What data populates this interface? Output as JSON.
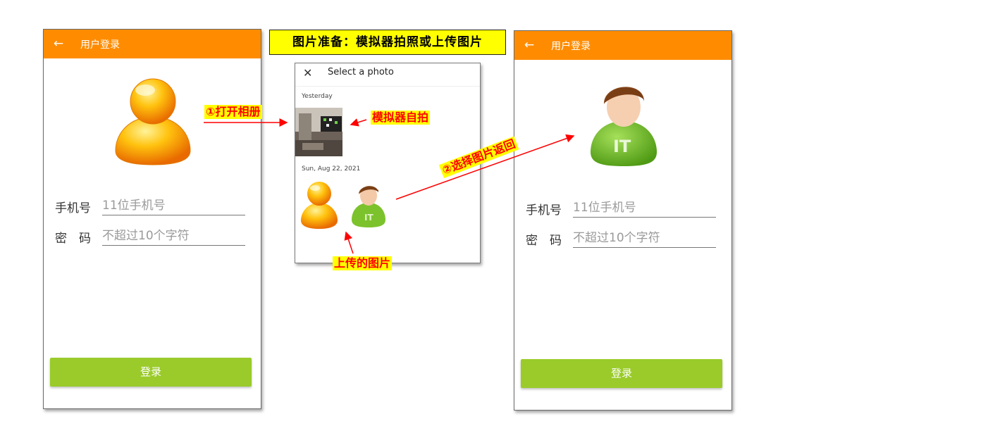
{
  "banner": {
    "text": "图片准备：模拟器拍照或上传图片"
  },
  "login_screen_before": {
    "appbar": {
      "back_icon": "←",
      "title": "用户登录"
    },
    "phone_label": "手机号",
    "phone_placeholder": "11位手机号",
    "password_label": "密　码",
    "password_placeholder": "不超过10个字符",
    "login_button": "登录",
    "avatar_icon": "orange-person-avatar"
  },
  "photo_picker": {
    "close_icon": "✕",
    "title": "Select a photo",
    "sections": [
      {
        "label": "Yesterday",
        "photos": [
          "emulator-selfie"
        ]
      },
      {
        "label": "Sun, Aug 22, 2021",
        "photos": [
          "orange-person-avatar",
          "green-it-avatar"
        ]
      }
    ]
  },
  "login_screen_after": {
    "appbar": {
      "back_icon": "←",
      "title": "用户登录"
    },
    "phone_label": "手机号",
    "phone_placeholder": "11位手机号",
    "password_label": "密　码",
    "password_placeholder": "不超过10个字符",
    "login_button": "登录",
    "avatar_icon": "green-it-avatar"
  },
  "annotations": {
    "open_album": "①打开相册",
    "emulator_selfie": "模拟器自拍",
    "select_return": "②选择图片返回",
    "uploaded_images": "上传的图片"
  },
  "colors": {
    "appbar": "#ff8c00",
    "login_button": "#9acb2a",
    "banner_bg": "#ffff00",
    "callout_text": "#ff0000",
    "arrow": "#ff0000"
  }
}
